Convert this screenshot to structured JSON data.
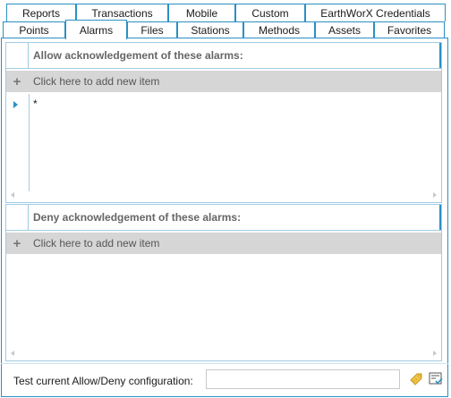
{
  "tabs_row1": [
    {
      "label": "Reports"
    },
    {
      "label": "Transactions"
    },
    {
      "label": "Mobile"
    },
    {
      "label": "Custom"
    },
    {
      "label": "EarthWorX Credentials"
    }
  ],
  "tabs_row2": [
    {
      "label": "Points"
    },
    {
      "label": "Alarms",
      "active": true
    },
    {
      "label": "Files"
    },
    {
      "label": "Stations"
    },
    {
      "label": "Methods"
    },
    {
      "label": "Assets"
    },
    {
      "label": "Favorites"
    }
  ],
  "allow_panel": {
    "header": "Allow acknowledgement of these alarms:",
    "add_label": "Click here to add new item",
    "rows": [
      {
        "value": "*"
      }
    ]
  },
  "deny_panel": {
    "header": "Deny acknowledgement of these alarms:",
    "add_label": "Click here to add new item",
    "rows": []
  },
  "test": {
    "label": "Test current Allow/Deny configuration:",
    "value": ""
  },
  "icons": {
    "test_run": "tag-icon",
    "test_result": "checklist-icon"
  },
  "colors": {
    "accent": "#2b8fc4",
    "add_row_bg": "#d6d6d6",
    "header_text": "#666666"
  }
}
